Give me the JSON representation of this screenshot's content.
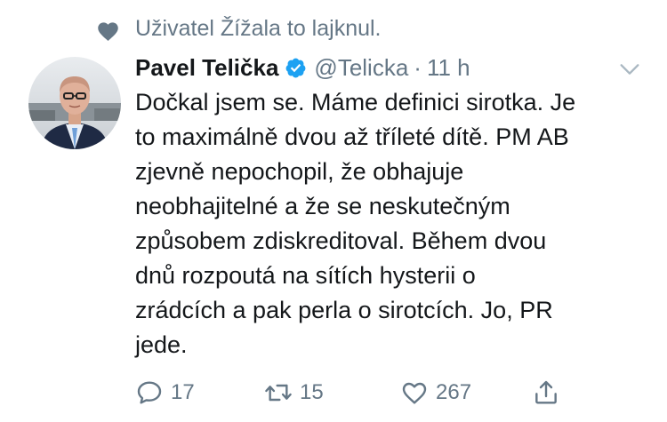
{
  "social_context": {
    "icon": "heart-icon",
    "text": "Uživatel Žížala to lajknul."
  },
  "author": {
    "avatar_icon": "avatar",
    "display_name": "Pavel Telička",
    "verified_icon": "verified-badge-icon",
    "handle": "@Telicka",
    "separator": "·",
    "time": "11 h"
  },
  "body": {
    "lines": [
      "Dočkal jsem se. Máme definici sirotka. Je",
      "to maximálně dvou až tříleté dítě. PM AB",
      "zjevně nepochopil, že obhajuje",
      "neobhajitelné a že se neskutečným",
      "způsobem zdiskreditoval. Během dvou",
      "dnů rozpoutá na sítích hysterii o",
      "zrádcích a pak perla o sirotcích. Jo, PR",
      "jede."
    ]
  },
  "actions": {
    "reply_count": "17",
    "retweet_count": "15",
    "like_count": "267",
    "share_icon": "share-icon"
  },
  "colors": {
    "text": "#14171a",
    "secondary": "#657786",
    "verified": "#1da1f2",
    "background": "#ffffff"
  }
}
